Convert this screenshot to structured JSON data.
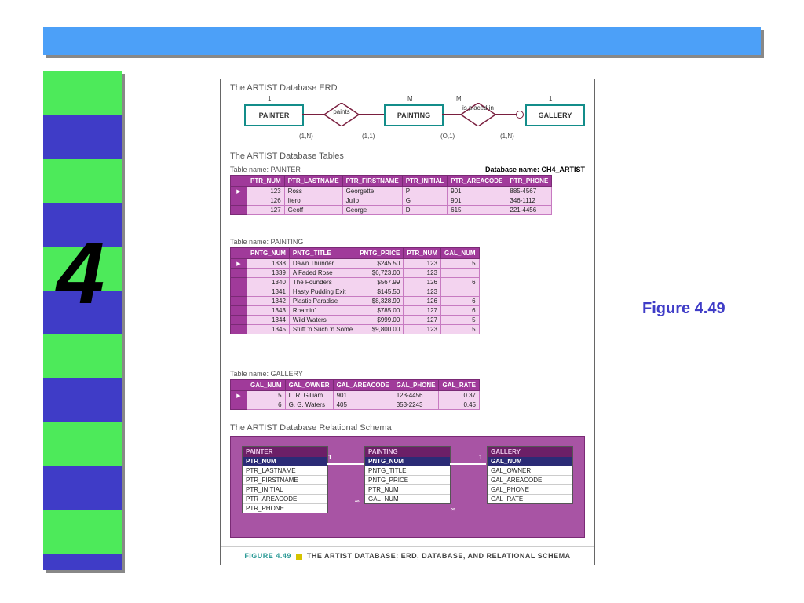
{
  "sidebar": {
    "number": "4"
  },
  "figure_label": "Figure 4.49",
  "erd": {
    "title": "The ARTIST Database ERD",
    "tables_title": "The ARTIST Database Tables",
    "entities": {
      "painter": "PAINTER",
      "painting": "PAINTING",
      "gallery": "GALLERY"
    },
    "rel": {
      "paints": "paints",
      "placed": "is placed in"
    },
    "card": {
      "p1": "1",
      "pM": "M",
      "g1": "1",
      "pN": "(1,N)",
      "p11": "(1,1)",
      "po1": "(O,1)",
      "g1N": "(1,N)"
    }
  },
  "db": {
    "label": "Database name: ",
    "name": "CH4_ARTIST"
  },
  "painter": {
    "label": "Table name: PAINTER",
    "headers": [
      "PTR_NUM",
      "PTR_LASTNAME",
      "PTR_FIRSTNAME",
      "PTR_INITIAL",
      "PTR_AREACODE",
      "PTR_PHONE"
    ],
    "rows": [
      [
        "123",
        "Ross",
        "Georgette",
        "P",
        "901",
        "885-4567"
      ],
      [
        "126",
        "Itero",
        "Julio",
        "G",
        "901",
        "346-1112"
      ],
      [
        "127",
        "Geoff",
        "George",
        "D",
        "615",
        "221-4456"
      ]
    ]
  },
  "painting": {
    "label": "Table name: PAINTING",
    "headers": [
      "PNTG_NUM",
      "PNTG_TITLE",
      "PNTG_PRICE",
      "PTR_NUM",
      "GAL_NUM"
    ],
    "rows": [
      [
        "1338",
        "Dawn Thunder",
        "$245.50",
        "123",
        "5"
      ],
      [
        "1339",
        "A Faded Rose",
        "$6,723.00",
        "123",
        ""
      ],
      [
        "1340",
        "The Founders",
        "$567.99",
        "126",
        "6"
      ],
      [
        "1341",
        "Hasty Pudding Exit",
        "$145.50",
        "123",
        ""
      ],
      [
        "1342",
        "Plastic Paradise",
        "$8,328.99",
        "126",
        "6"
      ],
      [
        "1343",
        "Roamin'",
        "$785.00",
        "127",
        "6"
      ],
      [
        "1344",
        "Wild Waters",
        "$999.00",
        "127",
        "5"
      ],
      [
        "1345",
        "Stuff 'n Such 'n Some",
        "$9,800.00",
        "123",
        "5"
      ]
    ]
  },
  "gallery": {
    "label": "Table name: GALLERY",
    "headers": [
      "GAL_NUM",
      "GAL_OWNER",
      "GAL_AREACODE",
      "GAL_PHONE",
      "GAL_RATE"
    ],
    "rows": [
      [
        "5",
        "L. R. Gilliam",
        "901",
        "123-4456",
        "0.37"
      ],
      [
        "6",
        "G. G. Waters",
        "405",
        "353-2243",
        "0.45"
      ]
    ]
  },
  "schema": {
    "title": "The ARTIST Database Relational Schema",
    "tables": {
      "painter": {
        "title": "PAINTER",
        "pk": "PTR_NUM",
        "fields": [
          "PTR_LASTNAME",
          "PTR_FIRSTNAME",
          "PTR_INITIAL",
          "PTR_AREACODE",
          "PTR_PHONE"
        ]
      },
      "painting": {
        "title": "PAINTING",
        "pk": "PNTG_NUM",
        "fields": [
          "PNTG_TITLE",
          "PNTG_PRICE",
          "PTR_NUM",
          "GAL_NUM"
        ]
      },
      "gallery": {
        "title": "GALLERY",
        "pk": "GAL_NUM",
        "fields": [
          "GAL_OWNER",
          "GAL_AREACODE",
          "GAL_PHONE",
          "GAL_RATE"
        ]
      }
    },
    "card": {
      "one": "1",
      "many": "∞"
    }
  },
  "footer": {
    "fig": "FIGURE 4.49",
    "text": "THE ARTIST DATABASE: ERD, DATABASE, AND RELATIONAL SCHEMA"
  }
}
